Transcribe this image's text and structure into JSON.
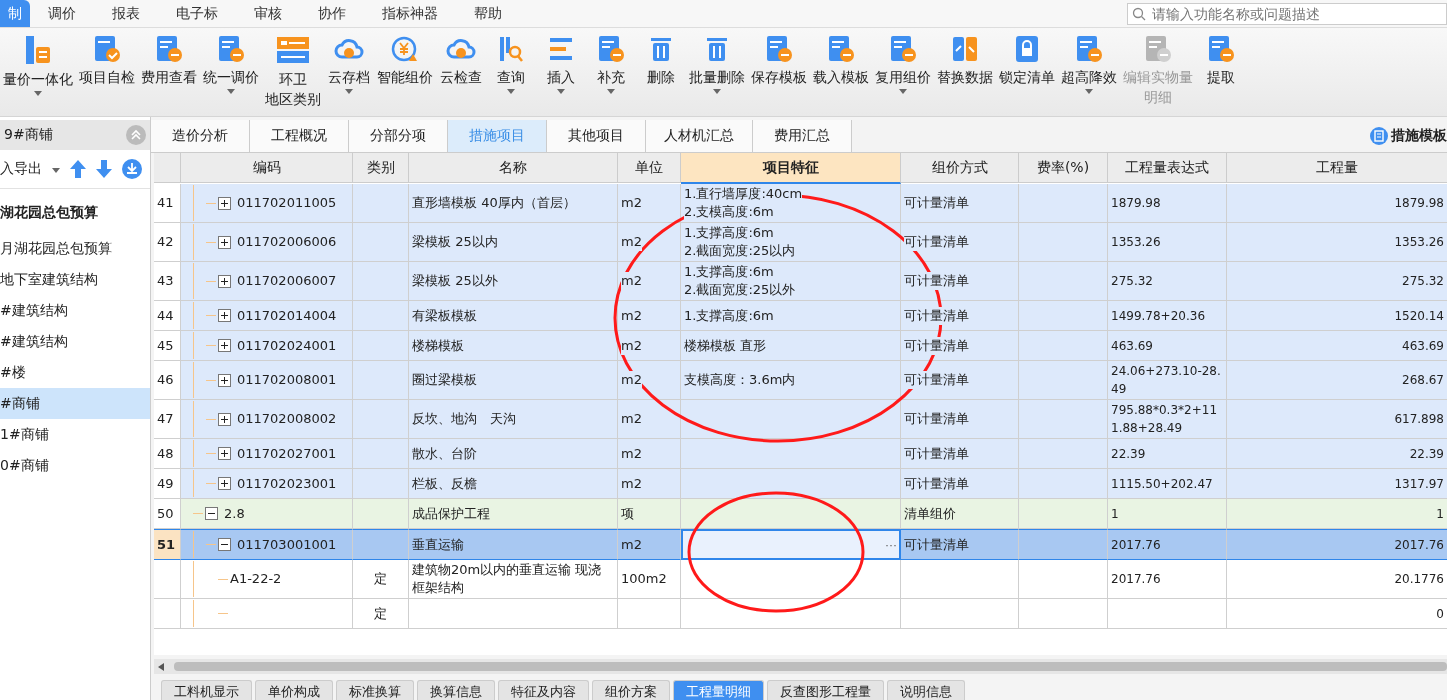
{
  "menu": [
    {
      "label": "制",
      "selected": true
    },
    {
      "label": "调价",
      "selected": false
    },
    {
      "label": "报表",
      "selected": false
    },
    {
      "label": "电子标",
      "selected": false
    },
    {
      "label": "审核",
      "selected": false
    },
    {
      "label": "协作",
      "selected": false
    },
    {
      "label": "指标神器",
      "selected": false
    },
    {
      "label": "帮助",
      "selected": false
    }
  ],
  "search": {
    "placeholder": "请输入功能名称或问题描述"
  },
  "toolbar": [
    {
      "label": "量价一体化",
      "kind": "split",
      "dropdown": true,
      "disabled": false
    },
    {
      "label": "项目自检",
      "kind": "check",
      "dropdown": false,
      "disabled": false
    },
    {
      "label": "费用查看",
      "kind": "doc",
      "dropdown": false,
      "disabled": false
    },
    {
      "label": "统一调价",
      "kind": "doc",
      "dropdown": true,
      "disabled": false
    },
    {
      "lines": [
        "环卫",
        "地区类别"
      ],
      "kind": "panel",
      "dropdown": false,
      "disabled": false
    },
    {
      "label": "云存档",
      "kind": "cloud",
      "dropdown": true,
      "disabled": false
    },
    {
      "label": "智能组价",
      "kind": "coin",
      "dropdown": false,
      "disabled": false
    },
    {
      "label": "云检查",
      "kind": "cloud",
      "dropdown": false,
      "disabled": false
    },
    {
      "label": "查询",
      "kind": "search",
      "dropdown": true,
      "disabled": false
    },
    {
      "label": "插入",
      "kind": "list",
      "dropdown": true,
      "disabled": false
    },
    {
      "label": "补充",
      "kind": "doc",
      "dropdown": true,
      "disabled": false
    },
    {
      "label": "删除",
      "kind": "trash",
      "dropdown": false,
      "disabled": false
    },
    {
      "label": "批量删除",
      "kind": "trash",
      "dropdown": true,
      "disabled": false
    },
    {
      "label": "保存模板",
      "kind": "doc",
      "dropdown": false,
      "disabled": false
    },
    {
      "label": "载入模板",
      "kind": "doc",
      "dropdown": false,
      "disabled": false
    },
    {
      "label": "复用组价",
      "kind": "doc",
      "dropdown": true,
      "disabled": false
    },
    {
      "label": "替换数据",
      "kind": "swap",
      "dropdown": false,
      "disabled": false
    },
    {
      "label": "锁定清单",
      "kind": "lock",
      "dropdown": false,
      "disabled": false
    },
    {
      "label": "超高降效",
      "kind": "doc",
      "dropdown": true,
      "disabled": false
    },
    {
      "lines": [
        "编辑实物量",
        "明细"
      ],
      "kind": "doc",
      "dropdown": false,
      "disabled": true
    },
    {
      "label": "提取",
      "kind": "doc",
      "dropdown": false,
      "disabled": false
    }
  ],
  "sidebar": {
    "title": "9#商铺",
    "export_label": "入导出",
    "items": [
      {
        "label": "湖花园总包预算",
        "kind": "root",
        "selected": false
      },
      {
        "label": "月湖花园总包预算",
        "kind": "item",
        "selected": false
      },
      {
        "label": "地下室建筑结构",
        "kind": "item",
        "selected": false
      },
      {
        "label": "#建筑结构",
        "kind": "item",
        "selected": false
      },
      {
        "label": "#建筑结构",
        "kind": "item",
        "selected": false
      },
      {
        "label": "#楼",
        "kind": "item",
        "selected": false
      },
      {
        "label": "#商铺",
        "kind": "item",
        "selected": true
      },
      {
        "label": "1#商铺",
        "kind": "item",
        "selected": false
      },
      {
        "label": "0#商铺",
        "kind": "item",
        "selected": false
      }
    ]
  },
  "tabs": [
    {
      "label": "造价分析",
      "selected": false
    },
    {
      "label": "工程概况",
      "selected": false
    },
    {
      "label": "分部分项",
      "selected": false
    },
    {
      "label": "措施项目",
      "selected": true
    },
    {
      "label": "其他项目",
      "selected": false
    },
    {
      "label": "人材机汇总",
      "selected": false
    },
    {
      "label": "费用汇总",
      "selected": false
    }
  ],
  "template_button": "措施模板",
  "table": {
    "columns": [
      {
        "label": "编码",
        "selected": false
      },
      {
        "label": "类别",
        "selected": false
      },
      {
        "label": "名称",
        "selected": false
      },
      {
        "label": "单位",
        "selected": false
      },
      {
        "label": "项目特征",
        "selected": true
      },
      {
        "label": "组价方式",
        "selected": false
      },
      {
        "label": "费率(%)",
        "selected": false
      },
      {
        "label": "工程量表达式",
        "selected": false
      },
      {
        "label": "工程量",
        "selected": false
      }
    ],
    "rows_continued": [
      {
        "num": "41",
        "code": "011702011005",
        "name": "直形墙模板 40厚内（首层）",
        "unit": "m2",
        "feature": "1.直行墙厚度:40cm\n2.支模高度:6m",
        "method": "可计量清单",
        "expr": "1879.98",
        "qty": "1879.98",
        "kind": "item",
        "expanded": false,
        "selected": false
      },
      {
        "num": "42",
        "code": "011702006006",
        "name": "梁模板 25以内",
        "unit": "m2",
        "feature": "1.支撑高度:6m\n2.截面宽度:25以内",
        "method": "可计量清单",
        "expr": "1353.26",
        "qty": "1353.26",
        "kind": "item",
        "expanded": false,
        "selected": false
      },
      {
        "num": "43",
        "code": "011702006007",
        "name": "梁模板 25以外",
        "unit": "m2",
        "feature": "1.支撑高度:6m\n2.截面宽度:25以外",
        "method": "可计量清单",
        "expr": "275.32",
        "qty": "275.32",
        "kind": "item",
        "expanded": false,
        "selected": false
      },
      {
        "num": "44",
        "code": "011702014004",
        "name": "有梁板模板",
        "unit": "m2",
        "feature": "1.支撑高度:6m",
        "method": "可计量清单",
        "expr": "1499.78+20.36",
        "qty": "1520.14",
        "kind": "item",
        "expanded": false,
        "selected": false
      },
      {
        "num": "45",
        "code": "011702024001",
        "name": "楼梯模板",
        "unit": "m2",
        "feature": "楼梯模板 直形",
        "method": "可计量清单",
        "expr": "463.69",
        "qty": "463.69",
        "kind": "item",
        "expanded": false,
        "selected": false
      },
      {
        "num": "46",
        "code": "011702008001",
        "name": "圈过梁模板",
        "unit": "m2",
        "feature": "支模高度：3.6m内",
        "method": "可计量清单",
        "expr": "24.06+273.10-28.49",
        "qty": "268.67",
        "kind": "item",
        "expanded": false,
        "selected": false
      },
      {
        "num": "47",
        "code": "011702008002",
        "name": "反坎、地沟　天沟",
        "unit": "m2",
        "method": "可计量清单",
        "expr": "795.88*0.3*2+111.88+28.49",
        "qty": "617.898",
        "kind": "item",
        "expanded": false,
        "selected": false
      },
      {
        "num": "48",
        "code": "011702027001",
        "name": "散水、台阶",
        "unit": "m2",
        "method": "可计量清单",
        "expr": "22.39",
        "qty": "22.39",
        "kind": "item",
        "expanded": false,
        "selected": false
      },
      {
        "num": "49",
        "code": "011702023001",
        "name": "栏板、反檐",
        "unit": "m2",
        "method": "可计量清单",
        "expr": "1115.50+202.47",
        "qty": "1317.97",
        "kind": "item",
        "expanded": false,
        "selected": false
      }
    ],
    "rows": [
      {
        "num": "50",
        "code": "2.8",
        "name": "成品保护工程",
        "unit": "项",
        "method": "清单组价",
        "expr": "1",
        "qty": "1",
        "kind": "section",
        "expanded": true,
        "selected": false,
        "children": [
          {
            "num": "51",
            "code": "011703001001",
            "name": "垂直运输",
            "unit": "m2",
            "cell_button": "···",
            "method": "可计量清单",
            "expr": "2017.76",
            "qty": "2017.76",
            "kind": "item",
            "expanded": true,
            "selected": true,
            "children": [
              {
                "code": "A1-22-2",
                "type": "定",
                "name": "建筑物20m以内的垂直运输 现浇框架结构",
                "unit": "100m2",
                "expr": "2017.76",
                "qty": "20.1776",
                "kind": "quota",
                "selected": false
              },
              {
                "type": "定",
                "qty": "0",
                "kind": "quota",
                "selected": false
              }
            ]
          }
        ]
      }
    ]
  },
  "bottom_tabs": [
    {
      "label": "工料机显示",
      "selected": false
    },
    {
      "label": "单价构成",
      "selected": false
    },
    {
      "label": "标准换算",
      "selected": false
    },
    {
      "label": "换算信息",
      "selected": false
    },
    {
      "label": "特征及内容",
      "selected": false
    },
    {
      "label": "组价方案",
      "selected": false
    },
    {
      "label": "工程量明细",
      "selected": true
    },
    {
      "label": "反查图形工程量",
      "selected": false
    },
    {
      "label": "说明信息",
      "selected": false
    }
  ],
  "annotations": [
    {
      "kind": "circle"
    },
    {
      "kind": "circle"
    }
  ]
}
